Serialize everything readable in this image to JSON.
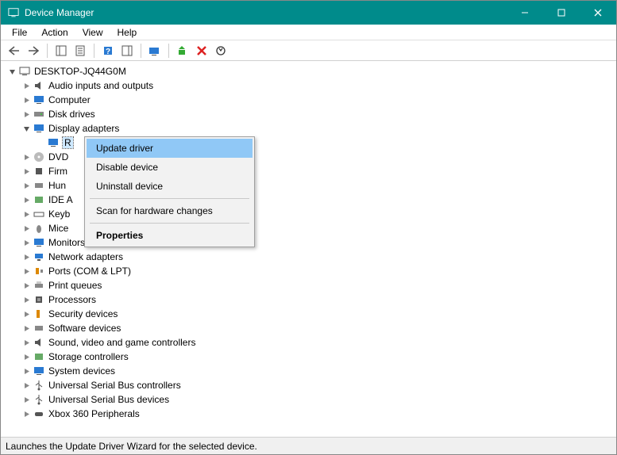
{
  "window": {
    "title": "Device Manager"
  },
  "menubar": {
    "file": "File",
    "action": "Action",
    "view": "View",
    "help": "Help"
  },
  "tree": {
    "root": "DESKTOP-JQ44G0M",
    "audio": "Audio inputs and outputs",
    "computer": "Computer",
    "disk": "Disk drives",
    "display": "Display adapters",
    "display_child": "R",
    "dvd": "DVD",
    "firmware": "Firm",
    "hid": "Hun",
    "ide": "IDE A",
    "keyboards": "Keyb",
    "mice": "Mice",
    "monitors": "Monitors",
    "network": "Network adapters",
    "ports": "Ports (COM & LPT)",
    "printq": "Print queues",
    "processors": "Processors",
    "security": "Security devices",
    "software": "Software devices",
    "sound": "Sound, video and game controllers",
    "storage": "Storage controllers",
    "system": "System devices",
    "usbctrl": "Universal Serial Bus controllers",
    "usbdev": "Universal Serial Bus devices",
    "xbox": "Xbox 360 Peripherals"
  },
  "context_menu": {
    "update": "Update driver",
    "disable": "Disable device",
    "uninstall": "Uninstall device",
    "scan": "Scan for hardware changes",
    "properties": "Properties"
  },
  "statusbar": {
    "text": "Launches the Update Driver Wizard for the selected device."
  }
}
